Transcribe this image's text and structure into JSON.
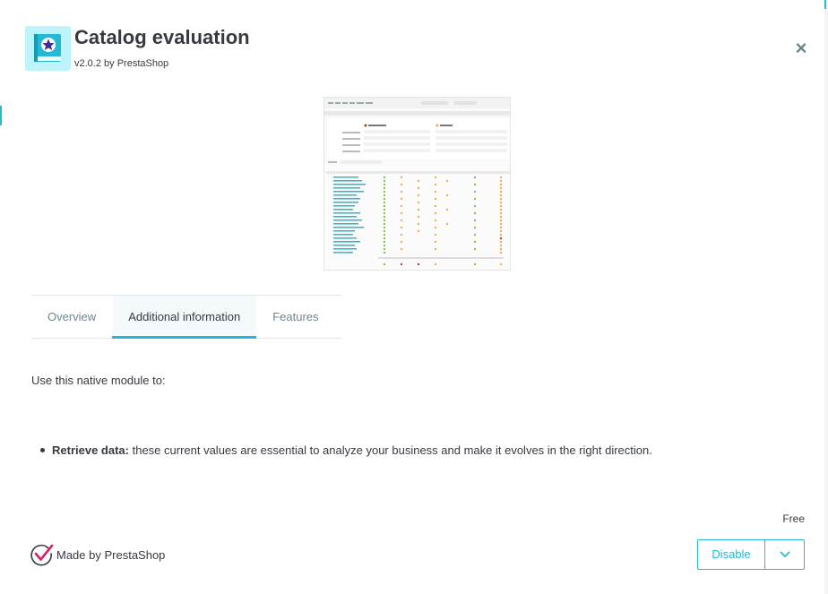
{
  "module": {
    "title": "Catalog evaluation",
    "version_line": "v2.0.2 by PrestaShop",
    "icon": "book-star-icon"
  },
  "close": {
    "glyph": "×"
  },
  "tabs": [
    {
      "label": "Overview",
      "active": false
    },
    {
      "label": "Additional information",
      "active": true
    },
    {
      "label": "Features",
      "active": false
    }
  ],
  "content": {
    "intro": "Use this native module to:",
    "bullet_bold": "Retrieve data:",
    "bullet_text": " these current values are essential to analyze your business and make it evolves in the right direction."
  },
  "price": "Free",
  "made_by": "Made by PrestaShop",
  "actions": {
    "primary_label": "Disable",
    "dropdown_icon": "chevron-down-icon"
  },
  "colors": {
    "accent": "#25b9d7",
    "logo_bg": "#bdf3fb",
    "text": "#363a41",
    "muted": "#6c868e",
    "check": "#d5236e"
  }
}
